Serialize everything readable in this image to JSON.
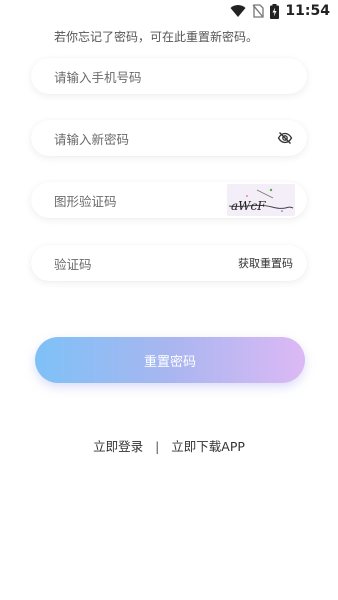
{
  "status_bar": {
    "time": "11:54",
    "icons": [
      "wifi-icon",
      "no-sim-icon",
      "battery-charging-icon"
    ]
  },
  "page": {
    "hint": "若你忘记了密码，可在此重置新密码。"
  },
  "form": {
    "phone": {
      "placeholder": "请输入手机号码"
    },
    "new_password": {
      "placeholder": "请输入新密码",
      "toggle_icon": "eye-off-icon"
    },
    "captcha": {
      "placeholder": "图形验证码",
      "image_text": "aWcF"
    },
    "sms_code": {
      "placeholder": "验证码",
      "get_code_label": "获取重置码"
    }
  },
  "actions": {
    "reset_label": "重置密码"
  },
  "footer": {
    "login_label": "立即登录",
    "separator": "|",
    "download_label": "立即下载APP"
  },
  "colors": {
    "button_gradient_start": "#7ec1f7",
    "button_gradient_end": "#dcb9f5"
  }
}
